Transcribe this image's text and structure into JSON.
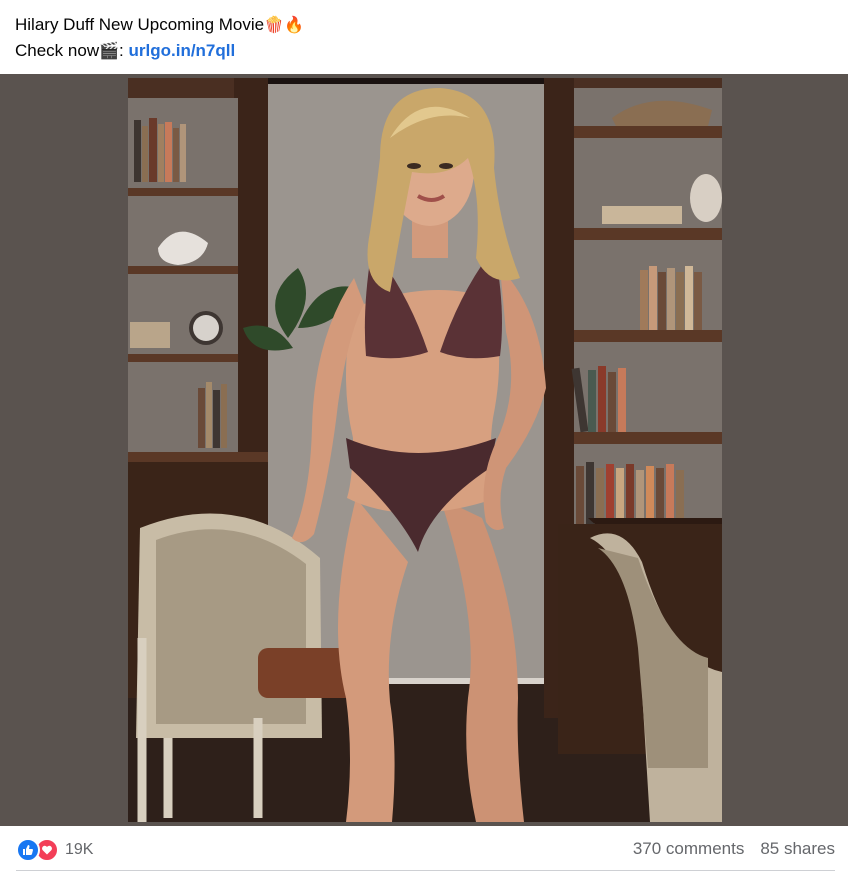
{
  "post": {
    "caption_line1": "Hilary Duff New Upcoming Movie",
    "caption_line1_emojis": "🍿🔥",
    "caption_line2_prefix": "Check now",
    "caption_line2_emoji": "🎬",
    "caption_line2_colon": ":",
    "link_text": "urlgo.in/n7qll"
  },
  "reactions": {
    "count": "19K",
    "like_icon": "thumbs-up-icon",
    "love_icon": "heart-icon",
    "like_color": "#1877f2",
    "love_color": "#f33e58"
  },
  "stats": {
    "comments": "370 comments",
    "shares": "85 shares"
  },
  "colors": {
    "link": "#216fdb",
    "frame_bg": "#5a534f",
    "muted_text": "#65676b"
  }
}
